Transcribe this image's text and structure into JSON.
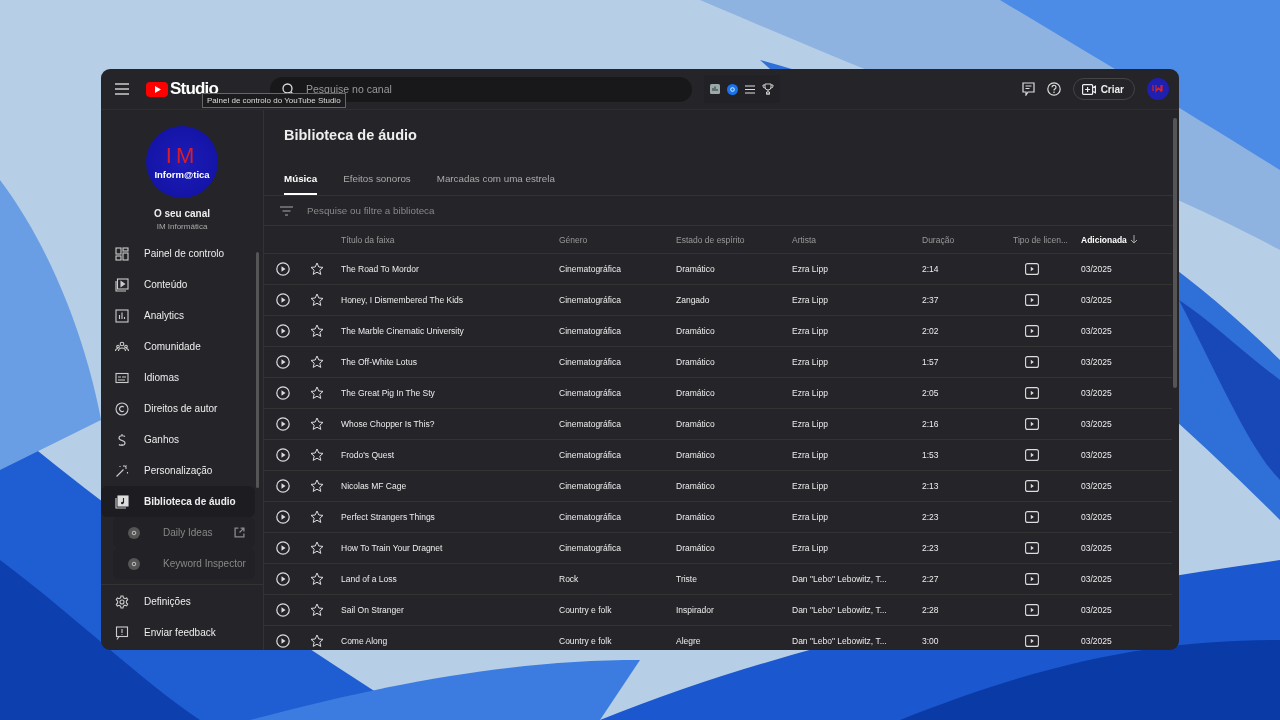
{
  "topbar": {
    "brand": "Studio",
    "search": {
      "placeholder": "Pesquise no canal"
    },
    "create_button": "Criar",
    "tooltip": "Painel de controlo do YouTube Studio"
  },
  "channel": {
    "avatar_mark": "IM",
    "avatar_label": "Inform@tica",
    "title": "O seu canal",
    "name": "IM Informática"
  },
  "sidebar": {
    "items": [
      {
        "label": "Painel de controlo",
        "kind": "nav",
        "selected": false
      },
      {
        "label": "Conteúdo",
        "kind": "nav",
        "selected": false
      },
      {
        "label": "Analytics",
        "kind": "nav",
        "selected": false
      },
      {
        "label": "Comunidade",
        "kind": "nav",
        "selected": false
      },
      {
        "label": "Idiomas",
        "kind": "nav",
        "selected": false
      },
      {
        "label": "Direitos de autor",
        "kind": "nav",
        "selected": false
      },
      {
        "label": "Ganhos",
        "kind": "nav",
        "selected": false
      },
      {
        "label": "Personalização",
        "kind": "nav",
        "selected": false
      },
      {
        "label": "Biblioteca de áudio",
        "kind": "nav",
        "selected": true
      },
      {
        "label": "Daily Ideas",
        "kind": "external_link",
        "selected": false
      },
      {
        "label": "Keyword Inspector",
        "kind": "extension",
        "selected": false
      }
    ],
    "footer": [
      {
        "label": "Definições"
      },
      {
        "label": "Enviar feedback"
      }
    ]
  },
  "page": {
    "title": "Biblioteca de áudio",
    "tabs": [
      {
        "label": "Música",
        "selected": true
      },
      {
        "label": "Efeitos sonoros",
        "selected": false
      },
      {
        "label": "Marcadas com uma estrela",
        "selected": false
      }
    ],
    "filter": {
      "placeholder": "Pesquise ou filtre a biblioteca"
    },
    "table": {
      "columns": [
        {
          "label": "Título da faixa",
          "sorted": false
        },
        {
          "label": "Género",
          "sorted": false
        },
        {
          "label": "Estado de espírito",
          "sorted": false
        },
        {
          "label": "Artista",
          "sorted": false
        },
        {
          "label": "Duração",
          "sorted": false
        },
        {
          "label": "Tipo de licen...",
          "sorted": false
        },
        {
          "label": "Adicionada",
          "sorted": true
        }
      ],
      "rows": [
        {
          "title": "The Road To Mordor",
          "genre": "Cinematográfica",
          "mood": "Dramático",
          "artist": "Ezra Lipp",
          "duration": "2:14",
          "added": "03/2025",
          "starred": false
        },
        {
          "title": "Honey, I Dismembered The Kids",
          "genre": "Cinematográfica",
          "mood": "Zangado",
          "artist": "Ezra Lipp",
          "duration": "2:37",
          "added": "03/2025",
          "starred": false
        },
        {
          "title": "The Marble Cinematic University",
          "genre": "Cinematográfica",
          "mood": "Dramático",
          "artist": "Ezra Lipp",
          "duration": "2:02",
          "added": "03/2025",
          "starred": false
        },
        {
          "title": "The Off-White Lotus",
          "genre": "Cinematográfica",
          "mood": "Dramático",
          "artist": "Ezra Lipp",
          "duration": "1:57",
          "added": "03/2025",
          "starred": false
        },
        {
          "title": "The Great Pig In The Sty",
          "genre": "Cinematográfica",
          "mood": "Dramático",
          "artist": "Ezra Lipp",
          "duration": "2:05",
          "added": "03/2025",
          "starred": false
        },
        {
          "title": "Whose Chopper Is This?",
          "genre": "Cinematográfica",
          "mood": "Dramático",
          "artist": "Ezra Lipp",
          "duration": "2:16",
          "added": "03/2025",
          "starred": false
        },
        {
          "title": "Frodo's Quest",
          "genre": "Cinematográfica",
          "mood": "Dramático",
          "artist": "Ezra Lipp",
          "duration": "1:53",
          "added": "03/2025",
          "starred": false
        },
        {
          "title": "Nicolas MF Cage",
          "genre": "Cinematográfica",
          "mood": "Dramático",
          "artist": "Ezra Lipp",
          "duration": "2:13",
          "added": "03/2025",
          "starred": false
        },
        {
          "title": "Perfect Strangers Things",
          "genre": "Cinematográfica",
          "mood": "Dramático",
          "artist": "Ezra Lipp",
          "duration": "2:23",
          "added": "03/2025",
          "starred": false
        },
        {
          "title": "How To Train Your Dragnet",
          "genre": "Cinematográfica",
          "mood": "Dramático",
          "artist": "Ezra Lipp",
          "duration": "2:23",
          "added": "03/2025",
          "starred": false
        },
        {
          "title": "Land of a Loss",
          "genre": "Rock",
          "mood": "Triste",
          "artist": "Dan \"Lebo\" Lebowitz, T...",
          "duration": "2:27",
          "added": "03/2025",
          "starred": false
        },
        {
          "title": "Sail On Stranger",
          "genre": "Country e folk",
          "mood": "Inspirador",
          "artist": "Dan \"Lebo\" Lebowitz, T...",
          "duration": "2:28",
          "added": "03/2025",
          "starred": false
        },
        {
          "title": "Come Along",
          "genre": "Country e folk",
          "mood": "Alegre",
          "artist": "Dan \"Lebo\" Lebowitz, T...",
          "duration": "3:00",
          "added": "03/2025",
          "starred": false
        }
      ]
    }
  }
}
